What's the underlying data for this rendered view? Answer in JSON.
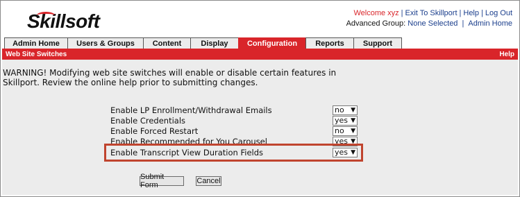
{
  "header": {
    "logo_text": "Skillsoft",
    "welcome": "Welcome xyz",
    "exit_link": "Exit To Skillport",
    "help_link": "Help",
    "logout_link": "Log Out",
    "advanced_group_label": "Advanced Group:",
    "none_selected_link": "None Selected",
    "admin_home_link": "Admin Home"
  },
  "tabs": [
    {
      "label": "Admin Home",
      "active": false
    },
    {
      "label": "Users & Groups",
      "active": false
    },
    {
      "label": "Content",
      "active": false
    },
    {
      "label": "Display",
      "active": false
    },
    {
      "label": "Configuration",
      "active": true
    },
    {
      "label": "Reports",
      "active": false
    },
    {
      "label": "Support",
      "active": false
    }
  ],
  "section": {
    "title": "Web Site Switches",
    "help": "Help"
  },
  "warning": {
    "line1": "WARNING! Modifying web site switches will enable or disable certain features in",
    "line2": "Skillport. Review the online help prior to submitting changes."
  },
  "switches": [
    {
      "label": "Enable LP Enrollment/Withdrawal Emails",
      "value": "no"
    },
    {
      "label": "Enable Credentials",
      "value": "yes"
    },
    {
      "label": "Enable Forced Restart",
      "value": "no"
    },
    {
      "label": "Enable Recommended for You Carousel",
      "value": "yes"
    },
    {
      "label": "Enable Transcript View Duration Fields",
      "value": "yes"
    }
  ],
  "buttons": {
    "submit": "Submit Form",
    "cancel": "Cancel"
  },
  "colors": {
    "brand_red": "#d9252a",
    "link_blue": "#1a3e8c",
    "highlight_box": "#c0442e"
  }
}
